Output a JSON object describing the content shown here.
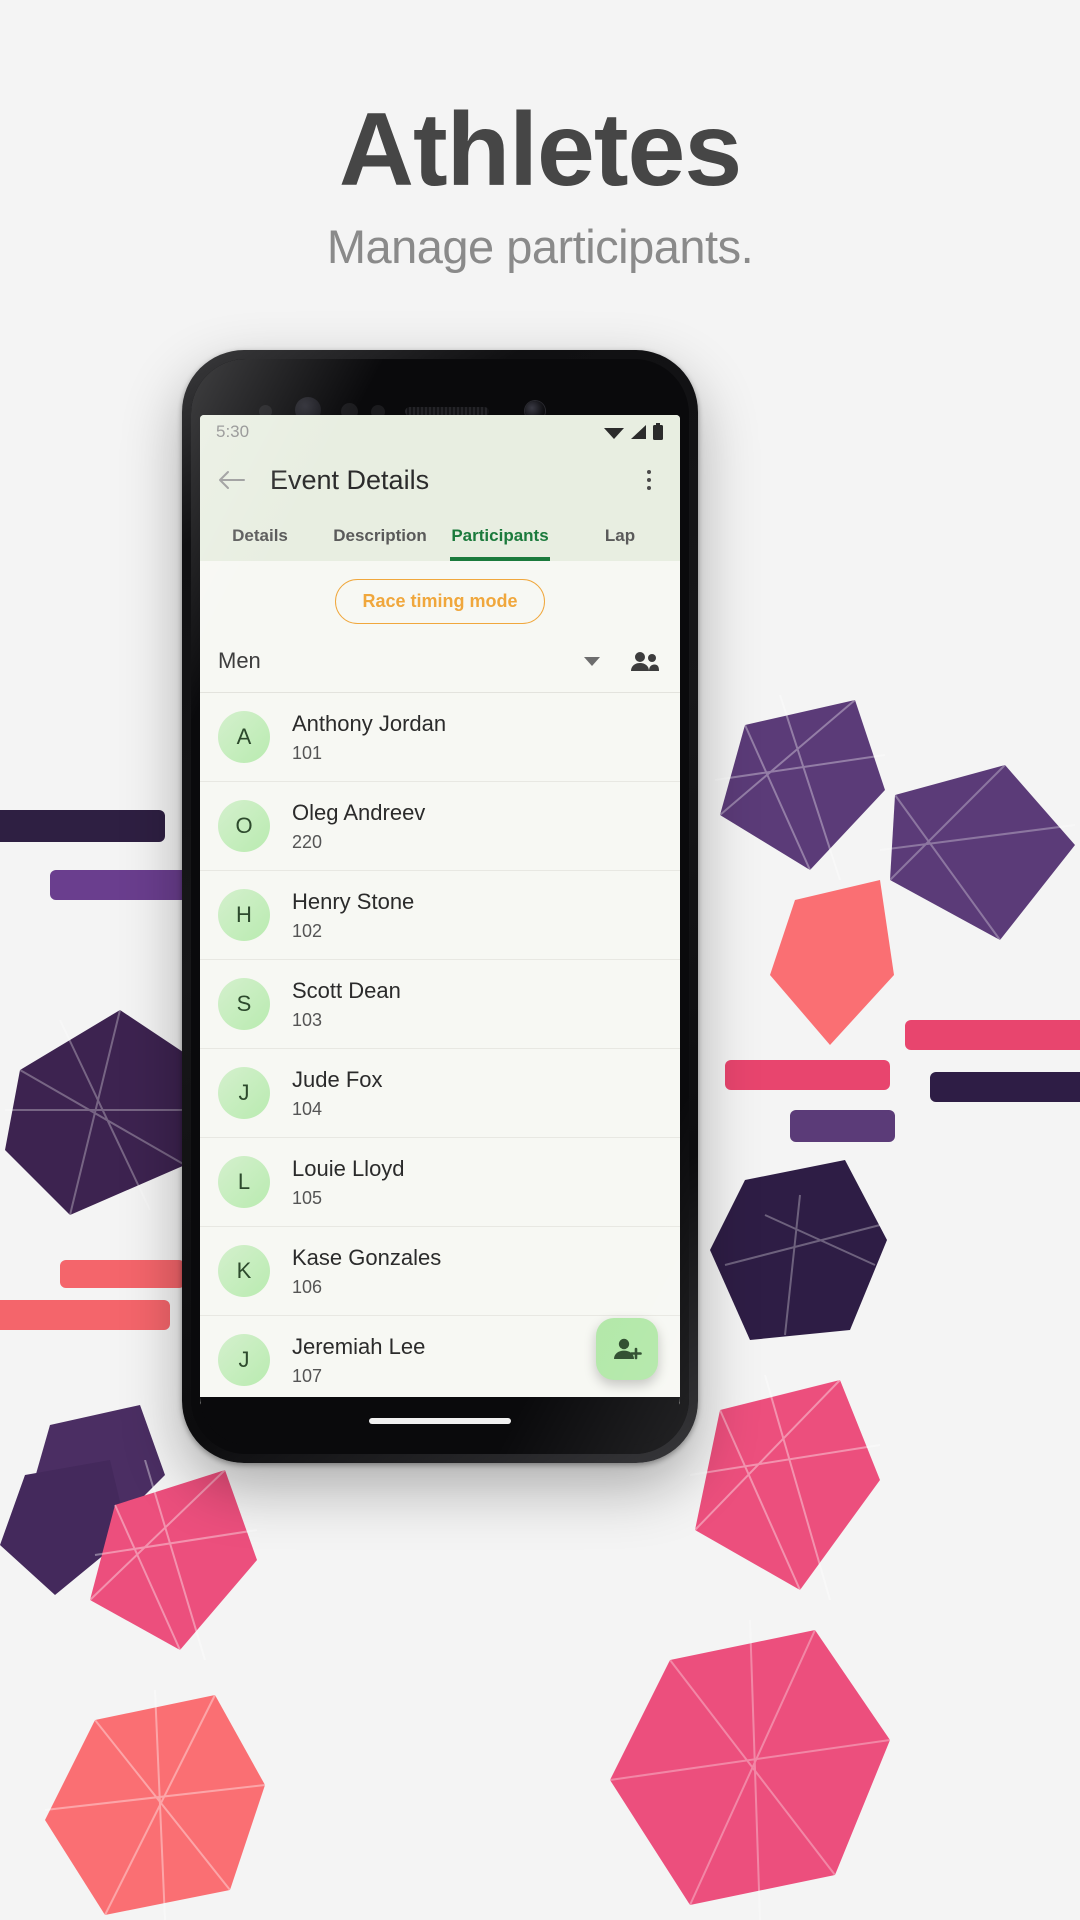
{
  "page": {
    "headline": "Athletes",
    "subhead": "Manage participants.",
    "background_color": "#f4f4f4",
    "headline_color": "#464646",
    "subhead_color": "#8a8a8a"
  },
  "phone": {
    "statusbar": {
      "time": "5:30",
      "icons": [
        "wifi-icon",
        "signal-icon",
        "battery-icon"
      ]
    },
    "appbar": {
      "back_icon": "back-arrow-icon",
      "title": "Event Details",
      "overflow_icon": "overflow-menu-icon"
    },
    "tabs": [
      {
        "label": "Details",
        "active": false
      },
      {
        "label": "Description",
        "active": false
      },
      {
        "label": "Participants",
        "active": true
      },
      {
        "label": "Lap",
        "active": false
      }
    ],
    "accent_color": "#1b7a3c",
    "chip": {
      "label": "Race timing mode",
      "color": "#f0a73c"
    },
    "filter": {
      "label": "Men",
      "caret_icon": "chevron-down-icon",
      "action_icon": "people-icon"
    },
    "participants": [
      {
        "initial": "A",
        "name": "Anthony Jordan",
        "number": "101"
      },
      {
        "initial": "O",
        "name": "Oleg Andreev",
        "number": "220"
      },
      {
        "initial": "H",
        "name": "Henry Stone",
        "number": "102"
      },
      {
        "initial": "S",
        "name": "Scott Dean",
        "number": "103"
      },
      {
        "initial": "J",
        "name": "Jude Fox",
        "number": "104"
      },
      {
        "initial": "L",
        "name": "Louie Lloyd",
        "number": "105"
      },
      {
        "initial": "K",
        "name": "Kase Gonzales",
        "number": "106"
      },
      {
        "initial": "J",
        "name": "Jeremiah Lee",
        "number": "107"
      }
    ],
    "fab": {
      "icon": "add-person-icon",
      "color": "#b2e8a8"
    }
  }
}
